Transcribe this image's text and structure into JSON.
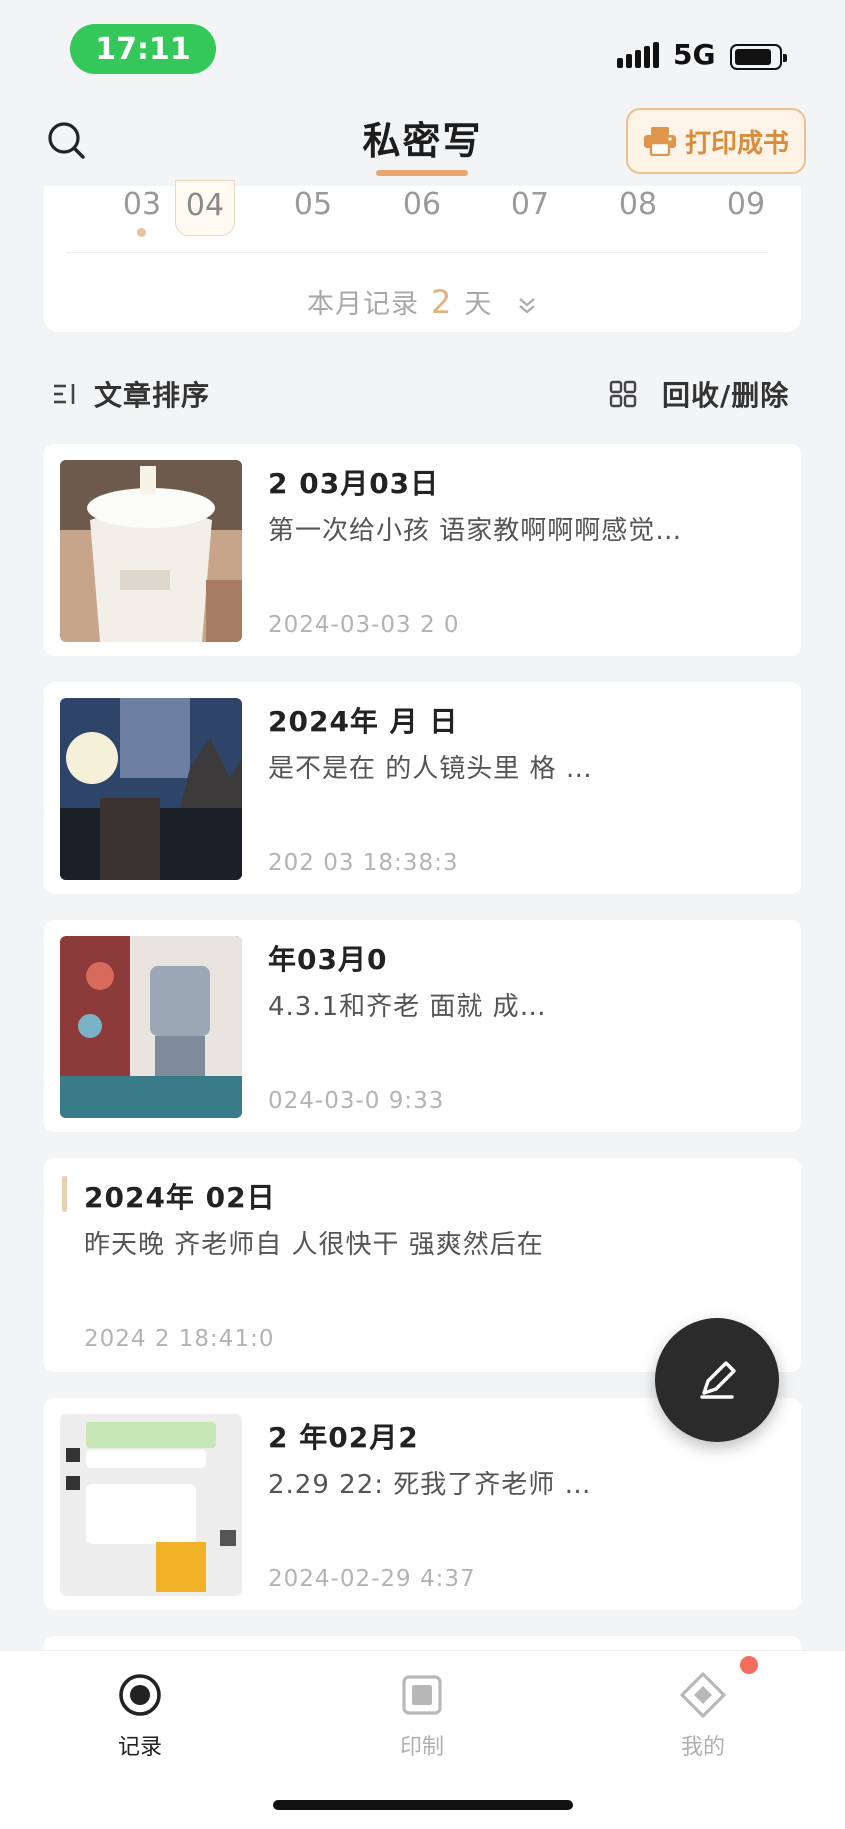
{
  "status_bar": {
    "time": "17:11",
    "network": "5G",
    "time_pill_color": "#34c759"
  },
  "header": {
    "title": "私密写",
    "print_button_label": "打印成书",
    "accent_color": "#e8a770"
  },
  "calendar": {
    "dates": [
      "03",
      "04",
      "05",
      "06",
      "07",
      "08",
      "09"
    ],
    "selected_date": "04",
    "dot_under": "03",
    "summary_prefix": "本月记录",
    "summary_count": "2",
    "summary_suffix": "天",
    "expand_icon": "chevron-double-down-icon"
  },
  "toolbar": {
    "sort_label": "文章排序",
    "recycle_label": "回收/删除",
    "sort_icon": "sort-lines-icon",
    "grid_icon": "grid-icon"
  },
  "entries": [
    {
      "title": "2 03月03日",
      "excerpt": "第一次给小孩 语家教啊啊啊感觉…",
      "time": "2024-03-03 2 0",
      "has_image": true
    },
    {
      "title": "2024年 月 日",
      "excerpt": "是不是在 的人镜头里 格 …",
      "time": "202 03 18:38:3",
      "has_image": true
    },
    {
      "title": "年03月0",
      "excerpt": "4.3.1和齐老 面就 成…",
      "time": "024-03-0 9:33",
      "has_image": true
    },
    {
      "title": "2024年 02日",
      "excerpt": "昨天晚 齐老师自 人很快干 强爽然后在",
      "time": "2024 2 18:41:0",
      "has_image": false
    },
    {
      "title": "2 年02月2",
      "excerpt": "2.29 22: 死我了齐老师 …",
      "time": "2024-02-29 4:37",
      "has_image": true
    }
  ],
  "tabs": [
    {
      "label": "记录",
      "icon": "record-icon",
      "active": true
    },
    {
      "label": "印制",
      "icon": "print-icon",
      "active": false
    },
    {
      "label": "我的",
      "icon": "profile-diamond-icon",
      "active": false
    }
  ],
  "colors": {
    "background": "#f3f4f6",
    "card": "#ffffff",
    "count_highlight": "#e3b27a",
    "badge": "#f26d5b"
  }
}
